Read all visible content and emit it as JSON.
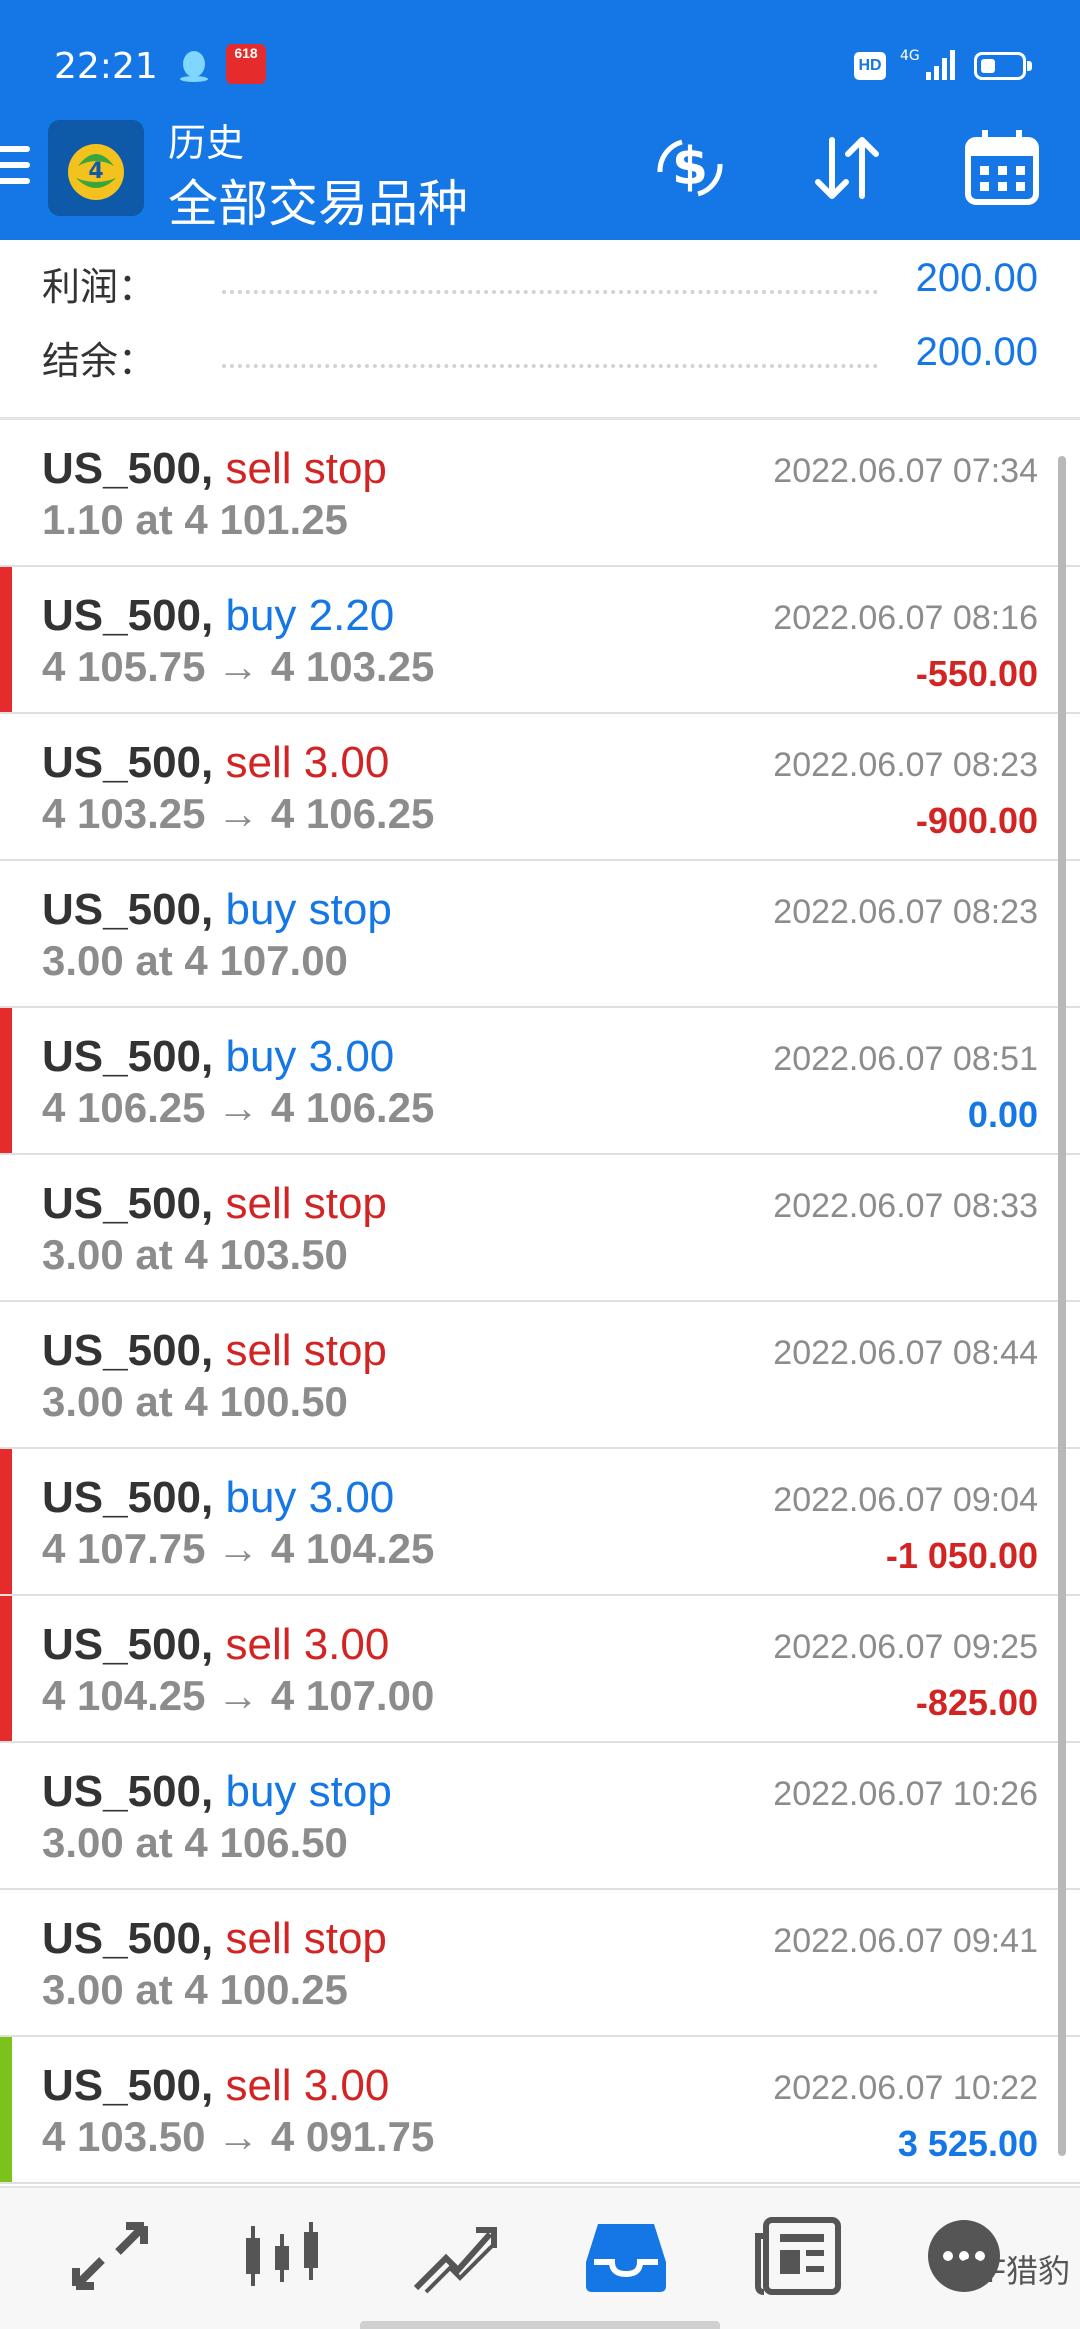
{
  "status": {
    "time": "22:21",
    "badge": "618",
    "hd": "HD",
    "network": "4G"
  },
  "header": {
    "title_small": "历史",
    "title_big": "全部交易品种"
  },
  "summary": [
    {
      "label": "利润：",
      "value": "200.00"
    },
    {
      "label": "结余：",
      "value": "200.00"
    }
  ],
  "trades": [
    {
      "symbol": "US_500,",
      "type": "sell stop",
      "dir": "sell",
      "detail": "1.10 at 4 101.25",
      "time": "2022.06.07 07:34",
      "profit": "",
      "bar": "none"
    },
    {
      "symbol": "US_500,",
      "type": "buy 2.20",
      "dir": "buy",
      "detail": "4 105.75 → 4 103.25",
      "time": "2022.06.07 08:16",
      "profit": "-550.00",
      "bar": "red"
    },
    {
      "symbol": "US_500,",
      "type": "sell 3.00",
      "dir": "sell",
      "detail": "4 103.25 → 4 106.25",
      "time": "2022.06.07 08:23",
      "profit": "-900.00",
      "bar": "none"
    },
    {
      "symbol": "US_500,",
      "type": "buy stop",
      "dir": "buy",
      "detail": "3.00 at 4 107.00",
      "time": "2022.06.07 08:23",
      "profit": "",
      "bar": "none"
    },
    {
      "symbol": "US_500,",
      "type": "buy 3.00",
      "dir": "buy",
      "detail": "4 106.25 → 4 106.25",
      "time": "2022.06.07 08:51",
      "profit": "0.00",
      "bar": "red"
    },
    {
      "symbol": "US_500,",
      "type": "sell stop",
      "dir": "sell",
      "detail": "3.00 at 4 103.50",
      "time": "2022.06.07 08:33",
      "profit": "",
      "bar": "none"
    },
    {
      "symbol": "US_500,",
      "type": "sell stop",
      "dir": "sell",
      "detail": "3.00 at 4 100.50",
      "time": "2022.06.07 08:44",
      "profit": "",
      "bar": "none"
    },
    {
      "symbol": "US_500,",
      "type": "buy 3.00",
      "dir": "buy",
      "detail": "4 107.75 → 4 104.25",
      "time": "2022.06.07 09:04",
      "profit": "-1 050.00",
      "bar": "red"
    },
    {
      "symbol": "US_500,",
      "type": "sell 3.00",
      "dir": "sell",
      "detail": "4 104.25 → 4 107.00",
      "time": "2022.06.07 09:25",
      "profit": "-825.00",
      "bar": "red"
    },
    {
      "symbol": "US_500,",
      "type": "buy stop",
      "dir": "buy",
      "detail": "3.00 at 4 106.50",
      "time": "2022.06.07 10:26",
      "profit": "",
      "bar": "none"
    },
    {
      "symbol": "US_500,",
      "type": "sell stop",
      "dir": "sell",
      "detail": "3.00 at 4 100.25",
      "time": "2022.06.07 09:41",
      "profit": "",
      "bar": "none"
    },
    {
      "symbol": "US_500,",
      "type": "sell 3.00",
      "dir": "sell",
      "detail": "4 103.50 → 4 091.75",
      "time": "2022.06.07 10:22",
      "profit": "3 525.00",
      "bar": "green"
    }
  ],
  "nav": [
    "quotes-icon",
    "chart-icon",
    "trade-icon",
    "history-icon",
    "news-icon",
    "chat-icon"
  ],
  "watermark": "@F猎豹",
  "colors": {
    "brand": "#1577e6",
    "sell": "#d32424",
    "loss_bar": "#e52b2b",
    "win_bar": "#7cc21c"
  }
}
